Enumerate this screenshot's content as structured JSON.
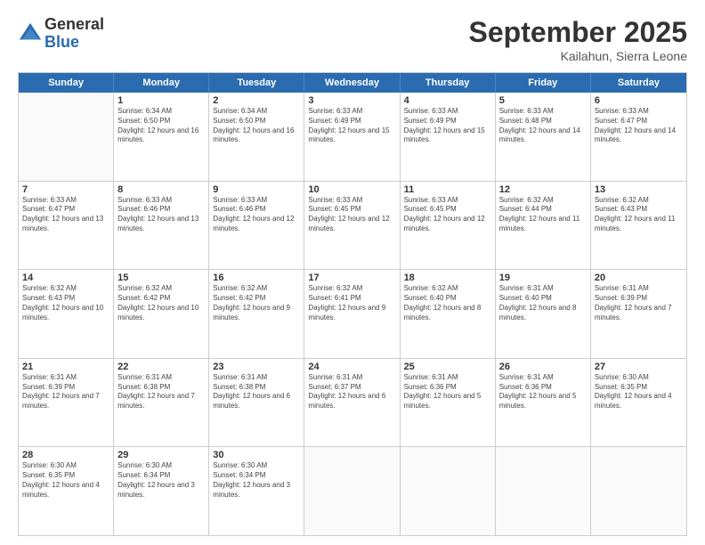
{
  "logo": {
    "general": "General",
    "blue": "Blue"
  },
  "title": "September 2025",
  "subtitle": "Kailahun, Sierra Leone",
  "header_days": [
    "Sunday",
    "Monday",
    "Tuesday",
    "Wednesday",
    "Thursday",
    "Friday",
    "Saturday"
  ],
  "weeks": [
    [
      {
        "day": "",
        "sunrise": "",
        "sunset": "",
        "daylight": ""
      },
      {
        "day": "1",
        "sunrise": "Sunrise: 6:34 AM",
        "sunset": "Sunset: 6:50 PM",
        "daylight": "Daylight: 12 hours and 16 minutes."
      },
      {
        "day": "2",
        "sunrise": "Sunrise: 6:34 AM",
        "sunset": "Sunset: 6:50 PM",
        "daylight": "Daylight: 12 hours and 16 minutes."
      },
      {
        "day": "3",
        "sunrise": "Sunrise: 6:33 AM",
        "sunset": "Sunset: 6:49 PM",
        "daylight": "Daylight: 12 hours and 15 minutes."
      },
      {
        "day": "4",
        "sunrise": "Sunrise: 6:33 AM",
        "sunset": "Sunset: 6:49 PM",
        "daylight": "Daylight: 12 hours and 15 minutes."
      },
      {
        "day": "5",
        "sunrise": "Sunrise: 6:33 AM",
        "sunset": "Sunset: 6:48 PM",
        "daylight": "Daylight: 12 hours and 14 minutes."
      },
      {
        "day": "6",
        "sunrise": "Sunrise: 6:33 AM",
        "sunset": "Sunset: 6:47 PM",
        "daylight": "Daylight: 12 hours and 14 minutes."
      }
    ],
    [
      {
        "day": "7",
        "sunrise": "Sunrise: 6:33 AM",
        "sunset": "Sunset: 6:47 PM",
        "daylight": "Daylight: 12 hours and 13 minutes."
      },
      {
        "day": "8",
        "sunrise": "Sunrise: 6:33 AM",
        "sunset": "Sunset: 6:46 PM",
        "daylight": "Daylight: 12 hours and 13 minutes."
      },
      {
        "day": "9",
        "sunrise": "Sunrise: 6:33 AM",
        "sunset": "Sunset: 6:46 PM",
        "daylight": "Daylight: 12 hours and 12 minutes."
      },
      {
        "day": "10",
        "sunrise": "Sunrise: 6:33 AM",
        "sunset": "Sunset: 6:45 PM",
        "daylight": "Daylight: 12 hours and 12 minutes."
      },
      {
        "day": "11",
        "sunrise": "Sunrise: 6:33 AM",
        "sunset": "Sunset: 6:45 PM",
        "daylight": "Daylight: 12 hours and 12 minutes."
      },
      {
        "day": "12",
        "sunrise": "Sunrise: 6:32 AM",
        "sunset": "Sunset: 6:44 PM",
        "daylight": "Daylight: 12 hours and 11 minutes."
      },
      {
        "day": "13",
        "sunrise": "Sunrise: 6:32 AM",
        "sunset": "Sunset: 6:43 PM",
        "daylight": "Daylight: 12 hours and 11 minutes."
      }
    ],
    [
      {
        "day": "14",
        "sunrise": "Sunrise: 6:32 AM",
        "sunset": "Sunset: 6:43 PM",
        "daylight": "Daylight: 12 hours and 10 minutes."
      },
      {
        "day": "15",
        "sunrise": "Sunrise: 6:32 AM",
        "sunset": "Sunset: 6:42 PM",
        "daylight": "Daylight: 12 hours and 10 minutes."
      },
      {
        "day": "16",
        "sunrise": "Sunrise: 6:32 AM",
        "sunset": "Sunset: 6:42 PM",
        "daylight": "Daylight: 12 hours and 9 minutes."
      },
      {
        "day": "17",
        "sunrise": "Sunrise: 6:32 AM",
        "sunset": "Sunset: 6:41 PM",
        "daylight": "Daylight: 12 hours and 9 minutes."
      },
      {
        "day": "18",
        "sunrise": "Sunrise: 6:32 AM",
        "sunset": "Sunset: 6:40 PM",
        "daylight": "Daylight: 12 hours and 8 minutes."
      },
      {
        "day": "19",
        "sunrise": "Sunrise: 6:31 AM",
        "sunset": "Sunset: 6:40 PM",
        "daylight": "Daylight: 12 hours and 8 minutes."
      },
      {
        "day": "20",
        "sunrise": "Sunrise: 6:31 AM",
        "sunset": "Sunset: 6:39 PM",
        "daylight": "Daylight: 12 hours and 7 minutes."
      }
    ],
    [
      {
        "day": "21",
        "sunrise": "Sunrise: 6:31 AM",
        "sunset": "Sunset: 6:39 PM",
        "daylight": "Daylight: 12 hours and 7 minutes."
      },
      {
        "day": "22",
        "sunrise": "Sunrise: 6:31 AM",
        "sunset": "Sunset: 6:38 PM",
        "daylight": "Daylight: 12 hours and 7 minutes."
      },
      {
        "day": "23",
        "sunrise": "Sunrise: 6:31 AM",
        "sunset": "Sunset: 6:38 PM",
        "daylight": "Daylight: 12 hours and 6 minutes."
      },
      {
        "day": "24",
        "sunrise": "Sunrise: 6:31 AM",
        "sunset": "Sunset: 6:37 PM",
        "daylight": "Daylight: 12 hours and 6 minutes."
      },
      {
        "day": "25",
        "sunrise": "Sunrise: 6:31 AM",
        "sunset": "Sunset: 6:36 PM",
        "daylight": "Daylight: 12 hours and 5 minutes."
      },
      {
        "day": "26",
        "sunrise": "Sunrise: 6:31 AM",
        "sunset": "Sunset: 6:36 PM",
        "daylight": "Daylight: 12 hours and 5 minutes."
      },
      {
        "day": "27",
        "sunrise": "Sunrise: 6:30 AM",
        "sunset": "Sunset: 6:35 PM",
        "daylight": "Daylight: 12 hours and 4 minutes."
      }
    ],
    [
      {
        "day": "28",
        "sunrise": "Sunrise: 6:30 AM",
        "sunset": "Sunset: 6:35 PM",
        "daylight": "Daylight: 12 hours and 4 minutes."
      },
      {
        "day": "29",
        "sunrise": "Sunrise: 6:30 AM",
        "sunset": "Sunset: 6:34 PM",
        "daylight": "Daylight: 12 hours and 3 minutes."
      },
      {
        "day": "30",
        "sunrise": "Sunrise: 6:30 AM",
        "sunset": "Sunset: 6:34 PM",
        "daylight": "Daylight: 12 hours and 3 minutes."
      },
      {
        "day": "",
        "sunrise": "",
        "sunset": "",
        "daylight": ""
      },
      {
        "day": "",
        "sunrise": "",
        "sunset": "",
        "daylight": ""
      },
      {
        "day": "",
        "sunrise": "",
        "sunset": "",
        "daylight": ""
      },
      {
        "day": "",
        "sunrise": "",
        "sunset": "",
        "daylight": ""
      }
    ]
  ]
}
